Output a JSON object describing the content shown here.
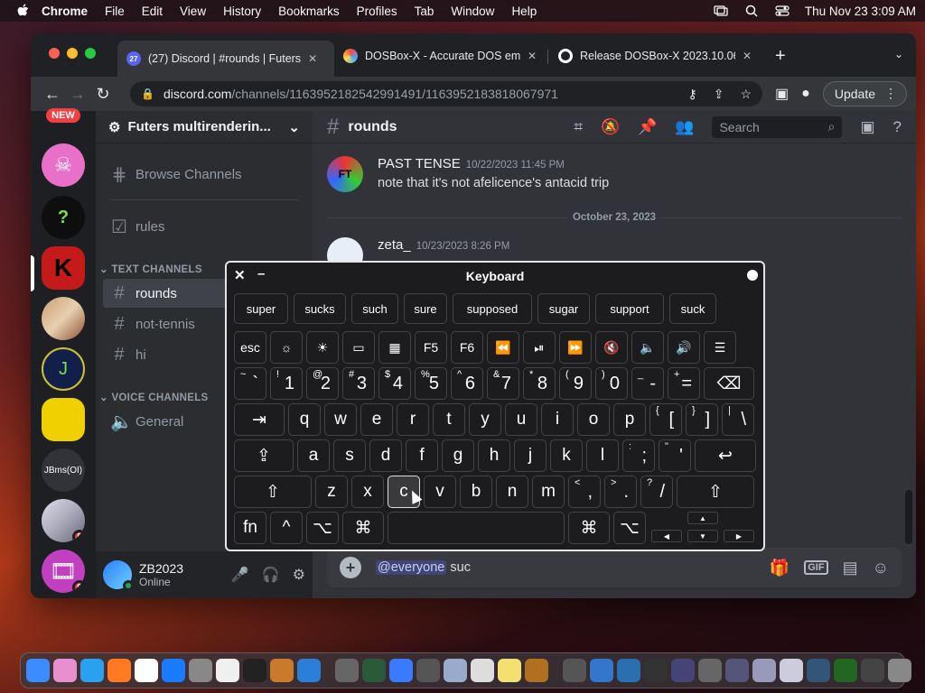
{
  "menubar": {
    "app": "Chrome",
    "items": [
      "File",
      "Edit",
      "View",
      "History",
      "Bookmarks",
      "Profiles",
      "Tab",
      "Window",
      "Help"
    ],
    "clock": "Thu Nov 23  3:09 AM"
  },
  "browser": {
    "tabs": [
      {
        "title": "(27) Discord | #rounds | Futers",
        "fav_text": "27"
      },
      {
        "title": "DOSBox-X - Accurate DOS em",
        "fav_text": ""
      },
      {
        "title": "Release DOSBox-X 2023.10.06",
        "fav_text": ""
      }
    ],
    "url_host": "discord.com",
    "url_path": "/channels/1163952182542991491/1163952183818067971",
    "update_label": "Update"
  },
  "discord": {
    "new_badge": "NEW",
    "server_text": "JBms(OI)",
    "server_letter": "J",
    "server_letter2": "K",
    "server_q": "?",
    "badges": [
      "8",
      "9"
    ],
    "guild_name": "Futers multirenderin...",
    "browse": "Browse Channels",
    "rules": "rules",
    "text_category": "TEXT CHANNELS",
    "text_channels": [
      "rounds",
      "not-tennis",
      "hi"
    ],
    "voice_category": "VOICE CHANNELS",
    "voice_channels": [
      "General"
    ],
    "user": {
      "name": "ZB2023",
      "status": "Online"
    },
    "channel_title": "rounds",
    "search_placeholder": "Search",
    "messages": [
      {
        "author": "PAST TENSE",
        "time": "10/22/2023 11:45 PM",
        "text": "note that it's not afelicence's antacid trip",
        "avatar_text": "FT"
      },
      {
        "author": "zeta_",
        "time": "10/23/2023 8:26 PM",
        "text": "",
        "avatar_text": ""
      }
    ],
    "date_divider": "October 23, 2023",
    "composer": {
      "mention": "@everyone",
      "typed": "suc"
    },
    "gif_label": "GIF"
  },
  "keyboard": {
    "title": "Keyboard",
    "suggestions": [
      "super",
      "sucks",
      "such",
      "sure",
      "supposed",
      "sugar",
      "support",
      "suck"
    ],
    "fn_row": [
      "esc",
      "☼",
      "☀",
      "▭",
      "▦",
      "F5",
      "F6",
      "⏪",
      "⏯",
      "⏩",
      "🔇",
      "🔈",
      "🔊",
      "☰"
    ],
    "num_row": [
      {
        "sub": "~",
        "main": "`"
      },
      {
        "sub": "!",
        "main": "1"
      },
      {
        "sub": "@",
        "main": "2"
      },
      {
        "sub": "#",
        "main": "3"
      },
      {
        "sub": "$",
        "main": "4"
      },
      {
        "sub": "%",
        "main": "5"
      },
      {
        "sub": "^",
        "main": "6"
      },
      {
        "sub": "&",
        "main": "7"
      },
      {
        "sub": "*",
        "main": "8"
      },
      {
        "sub": "(",
        "main": "9"
      },
      {
        "sub": ")",
        "main": "0"
      },
      {
        "sub": "_",
        "main": "-"
      },
      {
        "sub": "+",
        "main": "="
      }
    ],
    "delete": "⌫",
    "tab": "⇥",
    "q_row": [
      "q",
      "w",
      "e",
      "r",
      "t",
      "y",
      "u",
      "i",
      "o",
      "p"
    ],
    "q_row_extra": [
      {
        "sub": "{",
        "main": "["
      },
      {
        "sub": "}",
        "main": "]"
      },
      {
        "sub": "|",
        "main": "\\"
      }
    ],
    "caps": "⇪",
    "a_row": [
      "a",
      "s",
      "d",
      "f",
      "g",
      "h",
      "j",
      "k",
      "l"
    ],
    "a_row_extra": [
      {
        "sub": ":",
        "main": ";"
      },
      {
        "sub": "\"",
        "main": "'"
      }
    ],
    "return": "↩",
    "shift": "⇧",
    "z_row": [
      "z",
      "x",
      "c",
      "v",
      "b",
      "n",
      "m"
    ],
    "z_row_extra": [
      {
        "sub": "<",
        "main": ","
      },
      {
        "sub": ">",
        "main": "."
      },
      {
        "sub": "?",
        "main": "/"
      }
    ],
    "bottom": {
      "fn": "fn",
      "ctrl": "^",
      "opt": "⌥",
      "cmd": "⌘"
    },
    "arrows": {
      "up": "▲",
      "left": "◀",
      "down": "▼",
      "right": "▶"
    }
  }
}
